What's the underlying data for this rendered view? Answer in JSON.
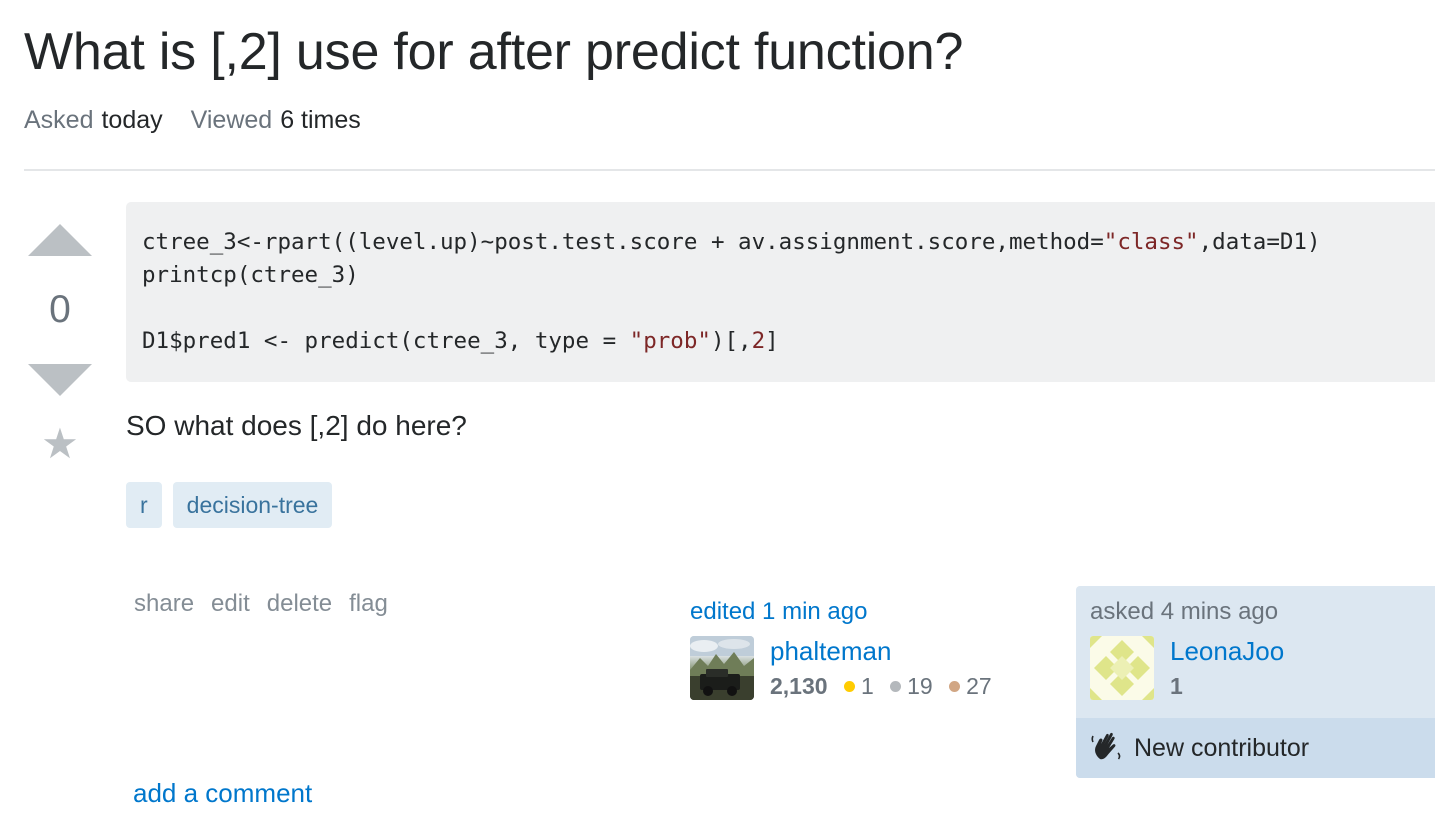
{
  "question": {
    "title": "What is [,2] use for after predict function?",
    "asked_label": "Asked",
    "asked_value": "today",
    "viewed_label": "Viewed",
    "viewed_value": "6 times",
    "vote_count": "0",
    "code_lines": [
      [
        {
          "t": "ctree_3<-rpart((level.up)~post.test.score + av.assignment.score,method="
        },
        {
          "t": "\"class\"",
          "c": "str"
        },
        {
          "t": ",data=D1)"
        }
      ],
      [
        {
          "t": "printcp(ctree_3)"
        }
      ],
      [
        {
          "t": ""
        }
      ],
      [
        {
          "t": "D1$pred1 <- predict(ctree_3, type = "
        },
        {
          "t": "\"prob\"",
          "c": "str"
        },
        {
          "t": ")[,"
        },
        {
          "t": "2",
          "c": "num"
        },
        {
          "t": "]"
        }
      ]
    ],
    "body_text": "SO what does [,2] do here?",
    "tags": [
      "r",
      "decision-tree"
    ],
    "menu": {
      "share": "share",
      "edit": "edit",
      "delete": "delete",
      "flag": "flag"
    },
    "add_comment": "add a comment"
  },
  "editor": {
    "edited_label": "edited 1 min ago",
    "name": "phalteman",
    "reputation": "2,130",
    "gold": "1",
    "silver": "19",
    "bronze": "27"
  },
  "asker": {
    "asked_label": "asked 4 mins ago",
    "name": "LeonaJoo",
    "reputation": "1",
    "new_contributor": "New contributor",
    "icon": "wave-hand-icon"
  },
  "colors": {
    "link": "#0077cc",
    "tag_bg": "#e1ecf4",
    "tag_text": "#39739d",
    "asker_bg": "#dce7f1",
    "badge_gold": "#ffcc01",
    "badge_silver": "#b4b8bc",
    "badge_bronze": "#d1a684"
  }
}
